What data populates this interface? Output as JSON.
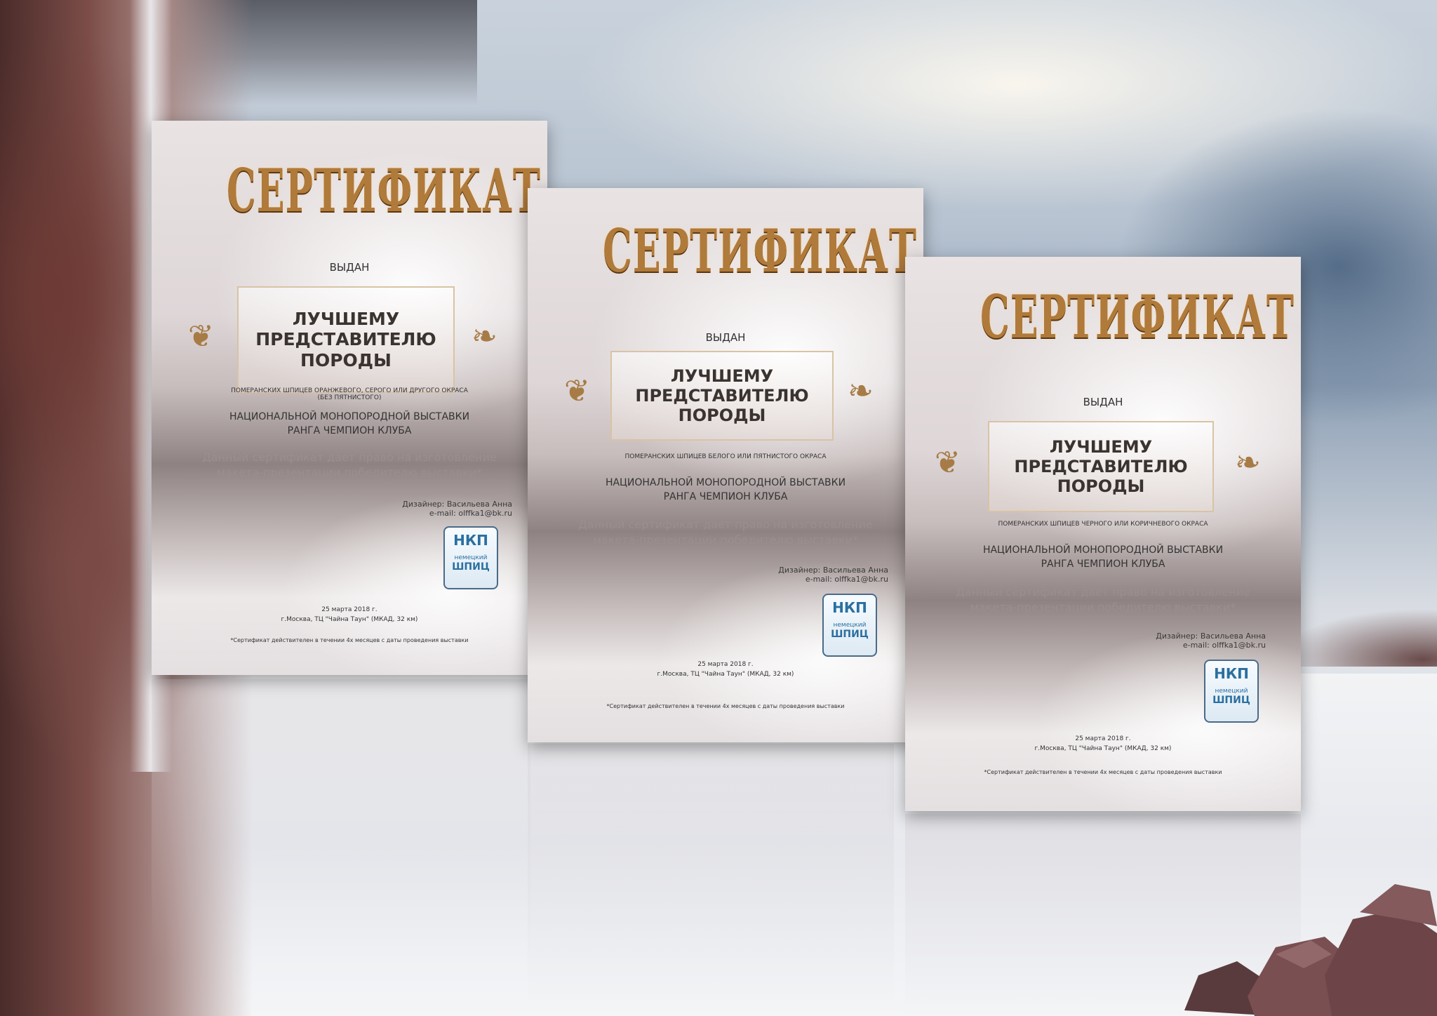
{
  "certificates": [
    {
      "title": "СЕРТИФИКАТ",
      "issued": "ВЫДАН",
      "award_line1": "ЛУЧШЕМУ",
      "award_line2": "ПРЕДСТАВИТЕЛЮ",
      "award_line3": "ПОРОДЫ",
      "breed_note": "ПОМЕРАНСКИХ ШПИЦЕВ ОРАНЖЕВОГО, СЕРОГО ИЛИ ДРУГОГО ОКРАСА (БЕЗ ПЯТНИСТОГО)",
      "show_line1": "НАЦИОНАЛЬНОЙ МОНОПОРОДНОЙ ВЫСТАВКИ",
      "show_line2": "РАНГА ЧЕМПИОН КЛУБА",
      "right_line1": "Данный сертификат дает право на изготовление",
      "right_line2": "макета-презентации победителю выставки*",
      "designer": "Дизайнер: Васильева Анна",
      "email": "e-mail: olffka1@bk.ru",
      "logo_top": "НКП",
      "logo_bottom": "немецкий",
      "logo_word": "ШПИЦ",
      "date": "25 марта 2018 г.",
      "place": "г.Москва, ТЦ \"Чайна Таун\" (МКАД, 32 км)",
      "footnote": "*Сертификат действителен в течении 4х месяцев с даты проведения выставки"
    },
    {
      "title": "СЕРТИФИКАТ",
      "issued": "ВЫДАН",
      "award_line1": "ЛУЧШЕМУ",
      "award_line2": "ПРЕДСТАВИТЕЛЮ",
      "award_line3": "ПОРОДЫ",
      "breed_note": "ПОМЕРАНСКИХ ШПИЦЕВ БЕЛОГО ИЛИ ПЯТНИСТОГО ОКРАСА",
      "show_line1": "НАЦИОНАЛЬНОЙ МОНОПОРОДНОЙ ВЫСТАВКИ",
      "show_line2": "РАНГА ЧЕМПИОН КЛУБА",
      "right_line1": "Данный сертификат дает право на изготовление",
      "right_line2": "макета-презентации победителю выставки*",
      "designer": "Дизайнер: Васильева Анна",
      "email": "e-mail: olffka1@bk.ru",
      "logo_top": "НКП",
      "logo_bottom": "немецкий",
      "logo_word": "ШПИЦ",
      "date": "25 марта 2018 г.",
      "place": "г.Москва, ТЦ \"Чайна Таун\" (МКАД, 32 км)",
      "footnote": "*Сертификат действителен в течении 4х месяцев с даты проведения выставки"
    },
    {
      "title": "СЕРТИФИКАТ",
      "issued": "ВЫДАН",
      "award_line1": "ЛУЧШЕМУ",
      "award_line2": "ПРЕДСТАВИТЕЛЮ",
      "award_line3": "ПОРОДЫ",
      "breed_note": "ПОМЕРАНСКИХ ШПИЦЕВ ЧЕРНОГО ИЛИ КОРИЧНЕВОГО ОКРАСА",
      "show_line1": "НАЦИОНАЛЬНОЙ МОНОПОРОДНОЙ ВЫСТАВКИ",
      "show_line2": "РАНГА ЧЕМПИОН КЛУБА",
      "right_line1": "Данный сертификат дает право на изготовление",
      "right_line2": "макета-презентации победителю выставки*",
      "designer": "Дизайнер: Васильева Анна",
      "email": "e-mail: olffka1@bk.ru",
      "logo_top": "НКП",
      "logo_bottom": "немецкий",
      "logo_word": "ШПИЦ",
      "date": "25 марта 2018 г.",
      "place": "г.Москва, ТЦ \"Чайна Таун\" (МКАД, 32 км)",
      "footnote": "*Сертификат действителен в течении 4х месяцев с даты проведения выставки"
    }
  ],
  "colors": {
    "gold": "#b07a3a",
    "text": "#333333",
    "logo_blue": "#2a6fa0"
  }
}
